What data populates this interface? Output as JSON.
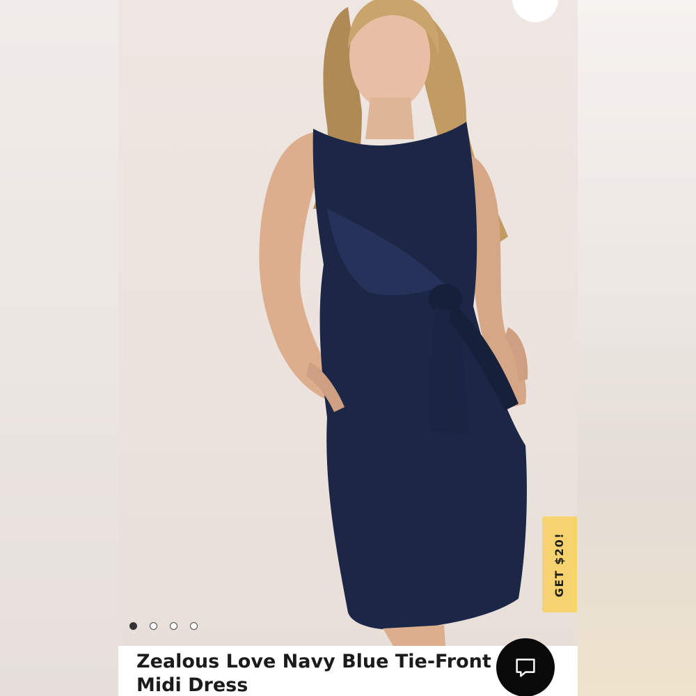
{
  "product": {
    "title": "Zealous Love Navy Blue Tie-Front Midi Dress"
  },
  "promo": {
    "label": "GET $20!"
  },
  "carousel": {
    "total": 4,
    "active_index": 0
  },
  "icons": {
    "top_action": "tag-icon",
    "chat": "chat-bubble-icon"
  },
  "colors": {
    "dress": "#1c2747",
    "promo_background": "#f6d36e",
    "chat_button": "#0a0a0a",
    "active_dot": "#333333"
  }
}
